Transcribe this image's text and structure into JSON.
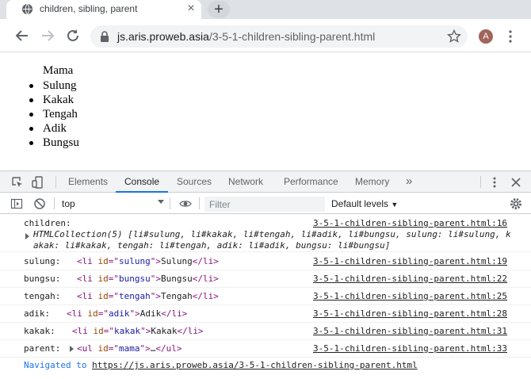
{
  "browser": {
    "tab_title": "children, sibling, parent",
    "url_host": "js.aris.proweb.asia",
    "url_path": "/3-5-1-children-sibling-parent.html",
    "avatar_letter": "A",
    "icons": [
      "globe-icon",
      "close-icon",
      "plus-icon",
      "back-arrow-icon",
      "forward-arrow-icon",
      "reload-icon",
      "lock-icon",
      "star-icon",
      "more-vert-icon"
    ]
  },
  "page": {
    "parent_text": "Mama",
    "children": [
      "Sulung",
      "Kakak",
      "Tengah",
      "Adik",
      "Bungsu"
    ]
  },
  "devtools": {
    "tabs": [
      "Elements",
      "Console",
      "Sources",
      "Network",
      "Performance",
      "Memory"
    ],
    "active_tab": "Console",
    "more_tabs": "»",
    "context": "top",
    "filter_placeholder": "Filter",
    "levels": "Default levels",
    "console": {
      "children_label": "children:",
      "children_src": "3-5-1-children-sibling-parent.html:16",
      "collection_line1": "HTMLCollection(5) [li#sulung, li#kakak, li#tengah, li#adik, li#bungsu, sulung: li#sulung, k",
      "collection_line2": "akak: li#kakak, tengah: li#tengah, adik: li#adik, bungsu: li#bungsu]",
      "entries": [
        {
          "label": "sulung:",
          "id": "sulung",
          "text": "Sulung",
          "src": "3-5-1-children-sibling-parent.html:19"
        },
        {
          "label": "bungsu:",
          "id": "bungsu",
          "text": "Bungsu",
          "src": "3-5-1-children-sibling-parent.html:22"
        },
        {
          "label": "tengah:",
          "id": "tengah",
          "text": "Tengah",
          "src": "3-5-1-children-sibling-parent.html:25"
        },
        {
          "label": "adik:",
          "id": "adik",
          "text": "Adik",
          "src": "3-5-1-children-sibling-parent.html:28"
        },
        {
          "label": "kakak:",
          "id": "kakak",
          "text": "Kakak",
          "src": "3-5-1-children-sibling-parent.html:31"
        }
      ],
      "parent_label": "parent:",
      "parent_id": "mama",
      "parent_src": "3-5-1-children-sibling-parent.html:33",
      "navigated_prefix": "Navigated to ",
      "navigated_url": "https://js.aris.proweb.asia/3-5-1-children-sibling-parent.html"
    }
  }
}
